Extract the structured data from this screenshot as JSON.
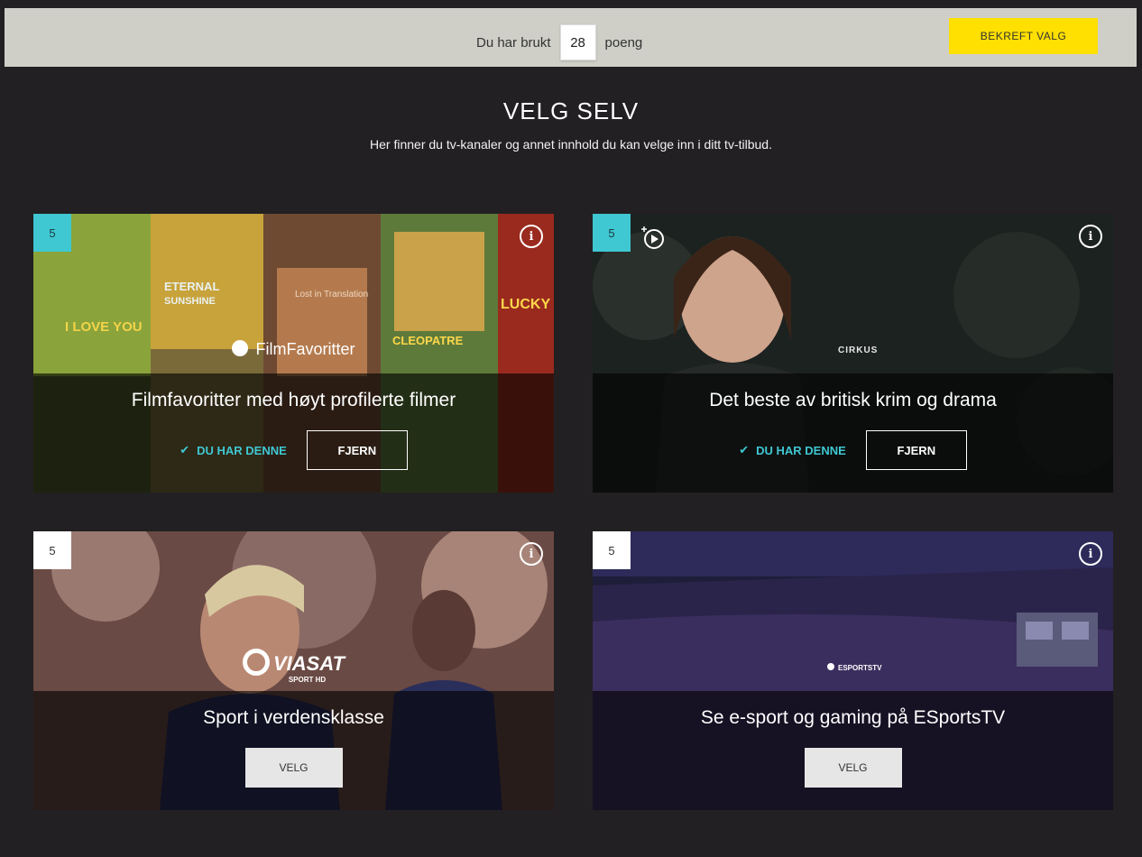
{
  "topbar": {
    "used_prefix": "Du har brukt",
    "used_points": "28",
    "used_suffix": "poeng",
    "confirm_label": "BEKREFT VALG"
  },
  "page": {
    "title": "VELG SELV",
    "subtitle": "Her finner du tv-kanaler og annet innhold du kan velge inn i ditt tv-tilbud."
  },
  "cards": [
    {
      "points": "5",
      "logo": "FilmFavoritter",
      "title": "Filmfavoritter med høyt profilerte filmer",
      "selected": true,
      "has_label": "DU HAR DENNE",
      "remove_label": "FJERN"
    },
    {
      "points": "5",
      "logo": "CIRKUS",
      "title": "Det beste av britisk krim og drama",
      "selected": true,
      "has_label": "DU HAR DENNE",
      "remove_label": "FJERN"
    },
    {
      "points": "5",
      "logo": "VIASAT",
      "logo_sub": "SPORT HD",
      "title": "Sport i verdensklasse",
      "selected": false,
      "choose_label": "VELG"
    },
    {
      "points": "5",
      "logo": "ESPORTSTV",
      "title": "Se e-sport og gaming på ESportsTV",
      "selected": false,
      "choose_label": "VELG"
    }
  ],
  "colors": {
    "accent_teal": "#3fc7d2",
    "confirm_yellow": "#ffe000",
    "background": "#222022"
  }
}
